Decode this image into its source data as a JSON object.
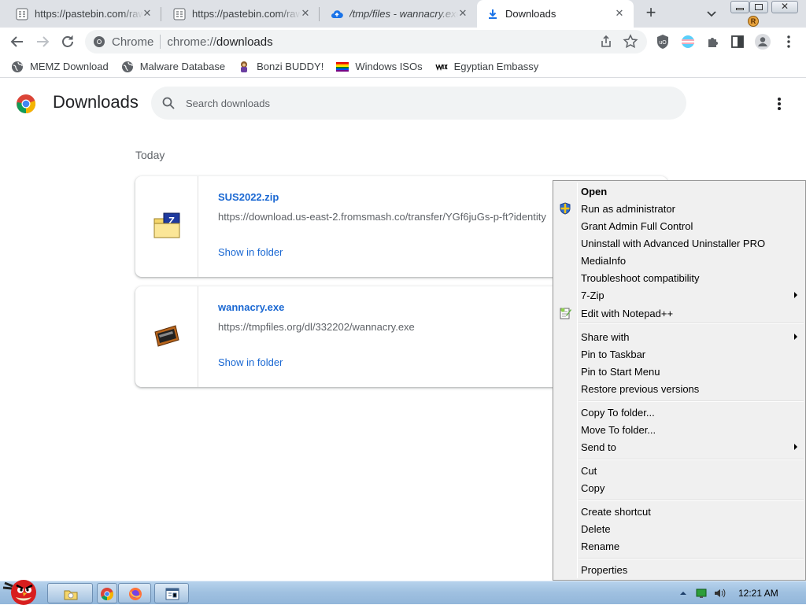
{
  "tabs": [
    {
      "title": "https://pastebin.com/raw/",
      "icon": "pastebin-icon"
    },
    {
      "title": "https://pastebin.com/raw/",
      "icon": "pastebin-icon"
    },
    {
      "title": "/tmp/files - wannacry.exe",
      "icon": "upload-cloud-icon"
    },
    {
      "title": "Downloads",
      "icon": "download-icon",
      "active": true
    }
  ],
  "toolbar": {
    "scheme_label": "Chrome",
    "url_prefix": "chrome://",
    "url_host": "downloads"
  },
  "bookmarks": [
    {
      "label": "MEMZ Download",
      "icon": "globe-icon"
    },
    {
      "label": "Malware Database",
      "icon": "globe-icon"
    },
    {
      "label": "Bonzi BUDDY!",
      "icon": "bonzi-icon"
    },
    {
      "label": "Windows ISOs",
      "icon": "rainbow-flag-icon"
    },
    {
      "label": "Egyptian Embassy",
      "icon": "wix-icon"
    }
  ],
  "downloads_page": {
    "title": "Downloads",
    "search_placeholder": "Search downloads",
    "section_label": "Today",
    "items": [
      {
        "filename": "SUS2022.zip",
        "url": "https://download.us-east-2.fromsmash.co/transfer/YGf6juGs-p-ft?identity",
        "action": "Show in folder",
        "icon": "zip-folder-icon"
      },
      {
        "filename": "wannacry.exe",
        "url": "https://tmpfiles.org/dl/332202/wannacry.exe",
        "action": "Show in folder",
        "icon": "exe-file-icon"
      }
    ]
  },
  "context_menu": {
    "items": [
      {
        "label": "Open",
        "bold": true
      },
      {
        "label": "Run as administrator",
        "icon": "uac-shield-icon"
      },
      {
        "label": "Grant Admin Full Control"
      },
      {
        "label": "Uninstall with Advanced Uninstaller PRO"
      },
      {
        "label": "MediaInfo"
      },
      {
        "label": "Troubleshoot compatibility"
      },
      {
        "label": "7-Zip",
        "submenu": true
      },
      {
        "label": "Edit with Notepad++",
        "icon": "notepadpp-icon"
      },
      {
        "separator": true
      },
      {
        "label": "Share with",
        "submenu": true
      },
      {
        "label": "Pin to Taskbar"
      },
      {
        "label": "Pin to Start Menu"
      },
      {
        "label": "Restore previous versions"
      },
      {
        "separator": true
      },
      {
        "label": "Copy To folder..."
      },
      {
        "label": "Move To folder..."
      },
      {
        "label": "Send to",
        "submenu": true
      },
      {
        "separator": true
      },
      {
        "label": "Cut"
      },
      {
        "label": "Copy"
      },
      {
        "separator": true
      },
      {
        "label": "Create shortcut"
      },
      {
        "label": "Delete"
      },
      {
        "label": "Rename"
      },
      {
        "separator": true
      },
      {
        "label": "Properties"
      }
    ]
  },
  "taskbar": {
    "start_icon": "angry-bird-start-icon",
    "buttons": [
      "explorer-icon",
      "chrome-icon",
      "firefox-icon",
      "window-icon"
    ],
    "clock": "12:21 AM"
  },
  "colors": {
    "tabstrip_bg": "#dee1e6",
    "link_blue": "#1967d2",
    "menu_bg": "#f0f0f0",
    "taskbar": "#9fc0e0"
  }
}
